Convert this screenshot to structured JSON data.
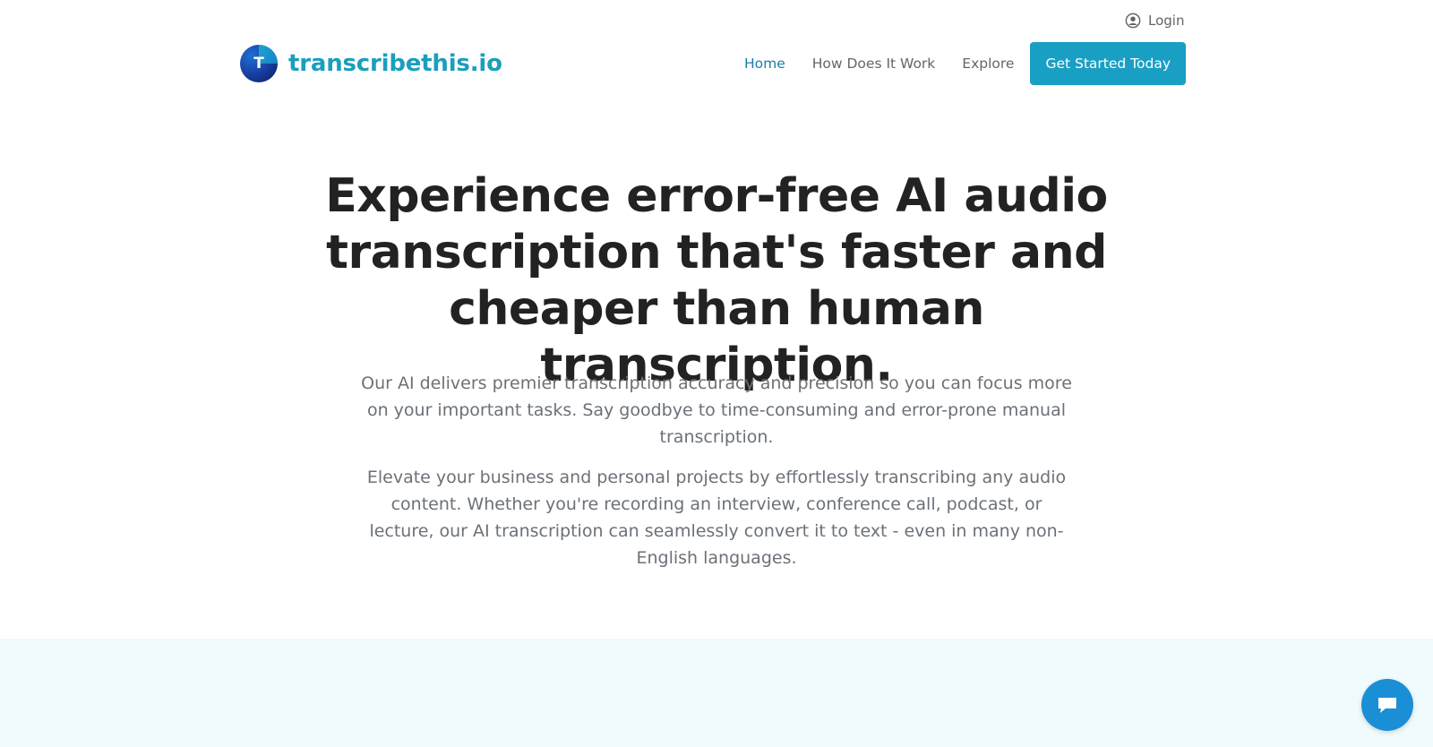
{
  "top_bar": {
    "login_label": "Login",
    "login_icon": "user-circle-icon"
  },
  "header": {
    "logo_letter": "T",
    "brand_name": "transcribethis.io",
    "nav": [
      {
        "label": "Home",
        "active": true
      },
      {
        "label": "How Does It Work",
        "active": false
      },
      {
        "label": "Explore",
        "active": false
      }
    ],
    "cta_label": "Get Started Today"
  },
  "hero": {
    "title": "Experience error-free AI audio transcription that's faster and cheaper than human transcription.",
    "paragraph_1": "Our AI delivers premier transcription accuracy and precision so you can focus more on your important tasks. Say goodbye to time-consuming and error-prone manual transcription.",
    "paragraph_2": "Elevate your business and personal projects by effortlessly transcribing any audio content. Whether you're recording an interview, conference call, podcast, or lecture, our AI transcription can seamlessly convert it to text - even in many non-English languages."
  },
  "chat": {
    "icon": "chat-bubble-icon"
  },
  "colors": {
    "brand": "#1a9fbd",
    "cta": "#1a9fc4",
    "nav_active": "#1a7fa6",
    "band_bg": "#effbfd",
    "chat": "#1a8fd6"
  }
}
